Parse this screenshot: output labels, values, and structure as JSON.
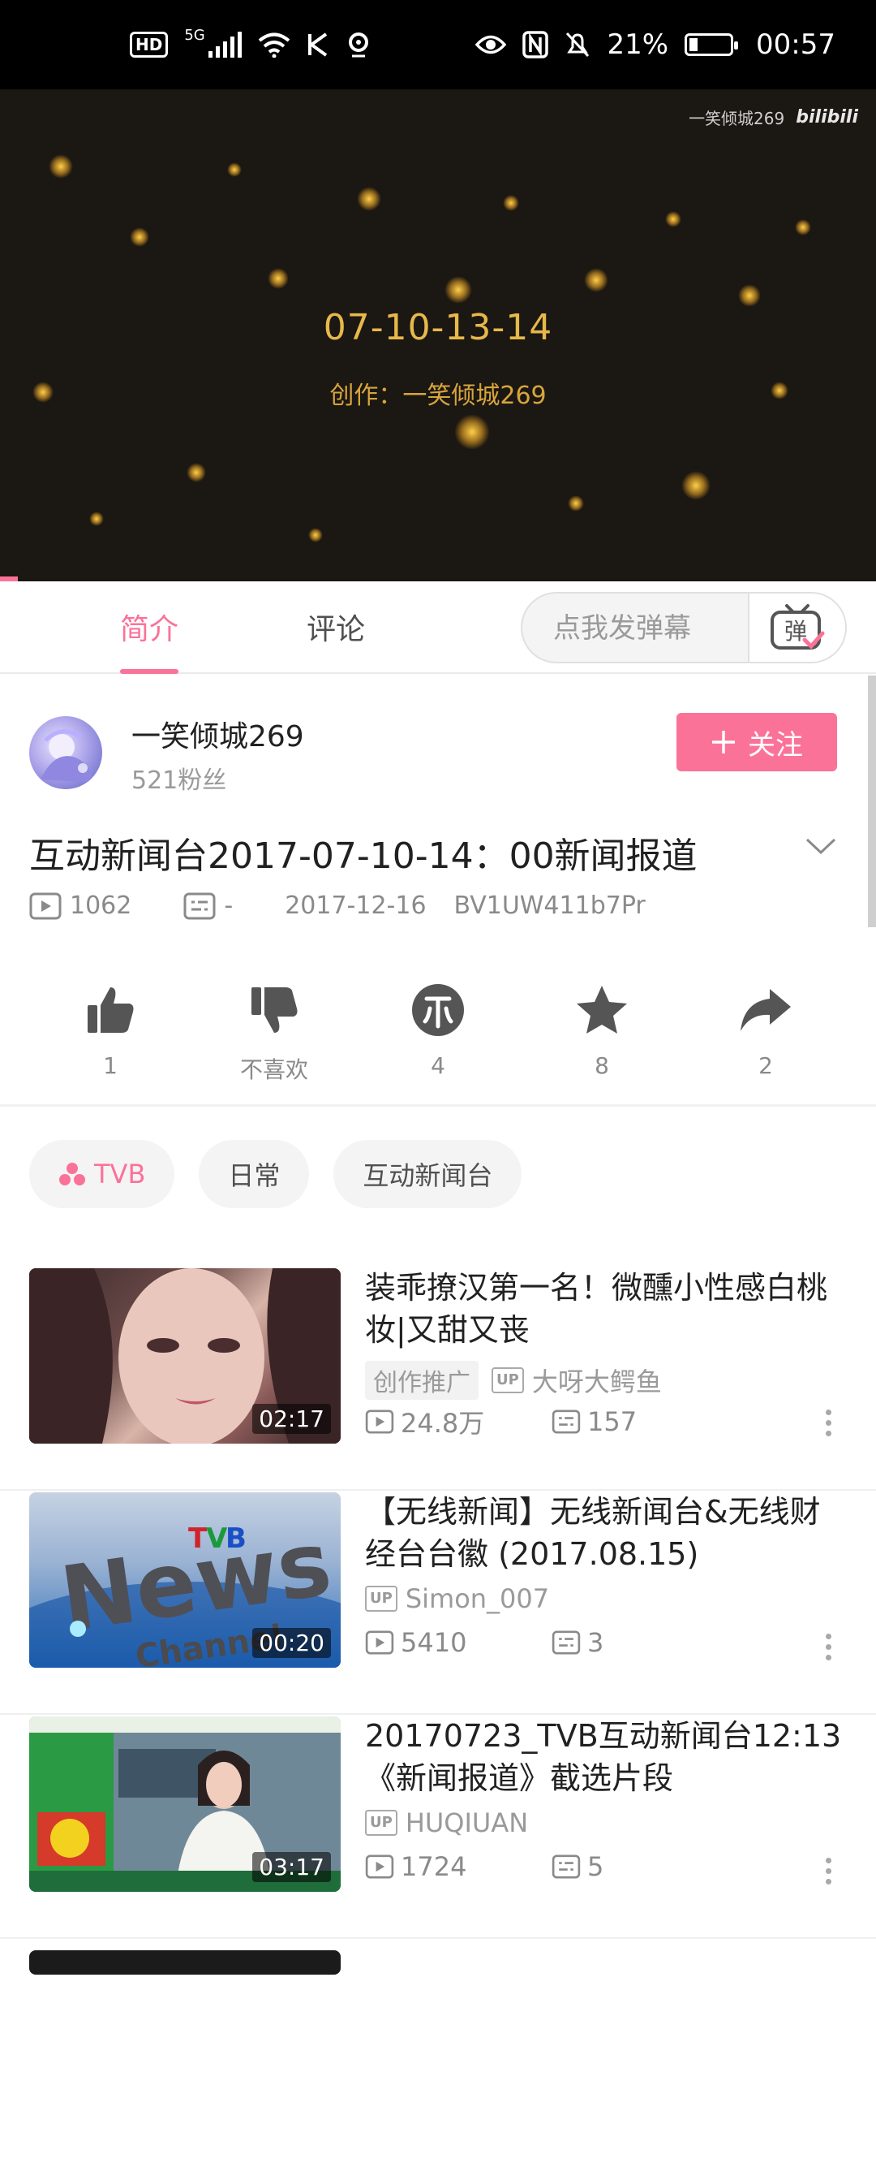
{
  "status_bar": {
    "hd_badge": "HD",
    "network": "5G",
    "battery_percent": "21%",
    "time": "00:57"
  },
  "player": {
    "title": "07-10-13-14",
    "subtitle": "创作：一笑倾城269",
    "watermark_text": "一笑倾城269",
    "watermark_logo": "bilibili",
    "progress_fraction": 0.02
  },
  "tabs": {
    "intro": "简介",
    "comments": "评论",
    "danmaku_placeholder": "点我发弹幕",
    "danmaku_button_glyph": "弹"
  },
  "uploader": {
    "name": "一笑倾城269",
    "fans": "521粉丝",
    "follow_label": "关注"
  },
  "video": {
    "title": "互动新闻台2017-07-10-14：00新闻报道",
    "views": "1062",
    "danmaku_count": "-",
    "date": "2017-12-16",
    "bvid": "BV1UW411b7Pr"
  },
  "actions": {
    "like": "1",
    "dislike": "不喜欢",
    "coin": "4",
    "favorite": "8",
    "share": "2"
  },
  "tags": [
    {
      "label": "TVB"
    },
    {
      "label": "日常"
    },
    {
      "label": "互动新闻台"
    }
  ],
  "related": [
    {
      "title": "装乖撩汉第一名！微醺小性感白桃妆|又甜又丧",
      "duration": "02:17",
      "promo": "创作推广",
      "up_badge": "UP",
      "author": "大呀大鳄鱼",
      "views": "24.8万",
      "danmaku": "157"
    },
    {
      "title": "【无线新闻】无线新闻台&无线财经台台徽 (2017.08.15)",
      "duration": "00:20",
      "up_badge": "UP",
      "author": "Simon_007",
      "views": "5410",
      "danmaku": "3"
    },
    {
      "title": "20170723_TVB互动新闻台12:13《新闻报道》截选片段",
      "duration": "03:17",
      "up_badge": "UP",
      "author": "HUQIUAN",
      "views": "1724",
      "danmaku": "5"
    }
  ],
  "colors": {
    "accent": "#fb7299",
    "player_bg": "#1b1712",
    "player_text": "#e7b84a"
  },
  "icons": [
    "play-count-icon",
    "danmaku-count-icon",
    "like-icon",
    "dislike-icon",
    "coin-icon",
    "favorite-icon",
    "share-icon",
    "chevron-down-icon",
    "plus-icon",
    "more-icon"
  ]
}
